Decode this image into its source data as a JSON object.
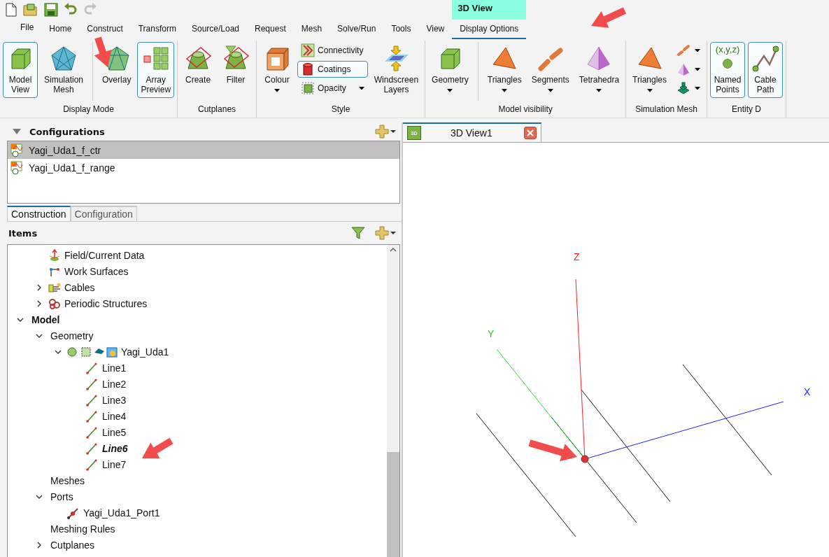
{
  "quick_access": [
    {
      "disabled": false
    },
    {
      "disabled": false
    },
    {
      "disabled": false
    },
    {
      "disabled": false
    },
    {
      "disabled": true
    }
  ],
  "ribbon": {
    "file_tab": "File",
    "context_label": "3D View",
    "tabs": [
      {
        "label": "Home",
        "selected": false
      },
      {
        "label": "Construct",
        "selected": false
      },
      {
        "label": "Transform",
        "selected": false
      },
      {
        "label": "Source/Load",
        "selected": false
      },
      {
        "label": "Request",
        "selected": false
      },
      {
        "label": "Mesh",
        "selected": false
      },
      {
        "label": "Solve/Run",
        "selected": false
      },
      {
        "label": "Tools",
        "selected": false
      },
      {
        "label": "View",
        "selected": false
      },
      {
        "label": "Display Options",
        "selected": true,
        "contextual": true
      }
    ],
    "groups": [
      {
        "label": "Display Mode",
        "buttons": [
          {
            "kind": "large",
            "label": "Model View",
            "on": true
          },
          {
            "kind": "large",
            "label": "Simulation Mesh",
            "on": false
          },
          {
            "kind": "large",
            "label": "Overlay",
            "on": false,
            "divider_before": true
          },
          {
            "kind": "large",
            "label": "Array Preview",
            "on": true
          }
        ]
      },
      {
        "label": "Cutplanes",
        "buttons": [
          {
            "kind": "large",
            "label": "Create",
            "on": false
          },
          {
            "kind": "large",
            "label": "Filter",
            "on": false
          }
        ]
      },
      {
        "label": "Style",
        "buttons": [
          {
            "kind": "large",
            "label": "Colour",
            "on": false,
            "dropdown": true
          },
          {
            "kind": "small",
            "label": "Connectivity",
            "on": false
          },
          {
            "kind": "small",
            "label": "Coatings",
            "on": true
          },
          {
            "kind": "small",
            "label": "Opacity",
            "on": false,
            "dropdown": true
          },
          {
            "kind": "large",
            "label": "Windscreen Layers",
            "on": false
          }
        ]
      },
      {
        "label": "Model visibility",
        "buttons": [
          {
            "kind": "large",
            "label": "Geometry",
            "on": false,
            "dropdown": true
          },
          {
            "kind": "large",
            "label": "Triangles",
            "on": false,
            "dropdown": true,
            "divider_before": true
          },
          {
            "kind": "large",
            "label": "Segments",
            "on": false,
            "dropdown": true
          },
          {
            "kind": "large",
            "label": "Tetrahedra",
            "on": false,
            "dropdown": true
          }
        ]
      },
      {
        "label": "Simulation Mesh",
        "buttons": [
          {
            "kind": "large",
            "label": "Triangles",
            "on": false,
            "dropdown": true
          },
          {
            "kind": "small",
            "on": false,
            "dropdown": true
          },
          {
            "kind": "small",
            "on": false,
            "dropdown": true
          },
          {
            "kind": "small",
            "on": false,
            "dropdown": true
          }
        ]
      },
      {
        "label": "Entity D",
        "buttons": [
          {
            "kind": "large",
            "label": "Named Points",
            "icon_text": "(x,y,z)",
            "on": true
          },
          {
            "kind": "large",
            "label": "Cable Path",
            "on": true
          }
        ]
      }
    ]
  },
  "configurations": {
    "title": "Configurations",
    "items": [
      {
        "label": "Yagi_Uda1_f_ctr",
        "selected": true
      },
      {
        "label": "Yagi_Uda1_f_range",
        "selected": false
      }
    ]
  },
  "panel_tabs": [
    {
      "label": "Construction",
      "selected": true
    },
    {
      "label": "Configuration",
      "selected": false
    }
  ],
  "items": {
    "title": "Items",
    "tree": [
      {
        "children": [
          {
            "label": "Field/Current Data",
            "kind": "field"
          },
          {
            "label": "Work Surfaces",
            "kind": "surface"
          },
          {
            "label": "Cables",
            "kind": "cable",
            "expanded": false
          },
          {
            "label": "Periodic Structures",
            "kind": "periodic",
            "expanded": false
          }
        ]
      },
      {
        "label": "Model",
        "kind": "section",
        "expanded": true,
        "children": [
          {
            "label": "Geometry",
            "kind": "folder",
            "expanded": true,
            "children": [
              {
                "label": "Yagi_Uda1",
                "kind": "part",
                "expanded": true,
                "children": [
                  {
                    "label": "Line1",
                    "kind": "line",
                    "emphasized": false
                  },
                  {
                    "label": "Line2",
                    "kind": "line",
                    "emphasized": false
                  },
                  {
                    "label": "Line3",
                    "kind": "line",
                    "emphasized": false
                  },
                  {
                    "label": "Line4",
                    "kind": "line",
                    "emphasized": false
                  },
                  {
                    "label": "Line5",
                    "kind": "line",
                    "emphasized": false
                  },
                  {
                    "label": "Line6",
                    "kind": "line",
                    "emphasized": true
                  },
                  {
                    "label": "Line7",
                    "kind": "line",
                    "emphasized": false
                  }
                ]
              }
            ]
          },
          {
            "label": "Meshes",
            "kind": "folder"
          },
          {
            "label": "Ports",
            "kind": "folder",
            "expanded": true,
            "children": [
              {
                "label": "Yagi_Uda1_Port1",
                "kind": "port"
              }
            ]
          },
          {
            "label": "Meshing Rules",
            "kind": "folder"
          },
          {
            "label": "Cutplanes",
            "kind": "folder",
            "expanded": false
          }
        ]
      }
    ]
  },
  "view": {
    "tabs": [
      {
        "label": "3D View1",
        "icon_text": "3D",
        "selected": true
      }
    ],
    "axes": {
      "x": "X",
      "y": "Y",
      "z": "Z"
    }
  }
}
